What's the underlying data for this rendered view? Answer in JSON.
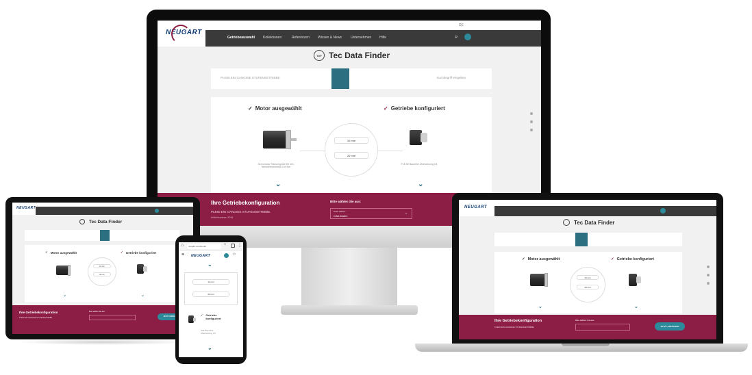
{
  "desktop": {
    "logo": "NEUGART",
    "nav_items": [
      "Getriebeauswahl",
      "Kollektionen",
      "Referenzen",
      "Wissen & News",
      "Unternehmen",
      "Hilfe"
    ],
    "lang": "DE",
    "page_title": "Tec Data Finder",
    "title_icon": "TDF",
    "search_left": "PLE60 EIN GANGIGE STUFENGETRIEBE",
    "search_right": "Suchbegriff eingeben",
    "motor_heading": "Motor ausgewählt",
    "gear_heading": "Getriebe konfiguriert",
    "value_top": "10 mm",
    "value_bottom": "20 mm",
    "motor_desc": "Servomotor Flanschgröße 60 mm, Nenndrehmoment 0,64 Nm",
    "gear_desc": "PLE 60 Baureihe Übersetzung i=5",
    "config_title": "Ihre Getriebekonfiguration",
    "config_product": "PLE60 EIN GANGIGE STUFENGETRIEBE",
    "config_article": "Artikelnummer: 5016",
    "config_question": "Bitte wählen Sie aus:",
    "config_select_label": "Datei wählen",
    "config_select_value": "CAD-Daten"
  },
  "tablet": {
    "logo": "NEUGART",
    "page_title": "Tec Data Finder",
    "motor_heading": "Motor ausgewählt",
    "gear_heading": "Getriebe konfiguriert",
    "value_top": "10 mm",
    "value_bottom": "20 mm",
    "config_title": "Ihre Getriebekonfiguration",
    "config_sub": "PLE60 EIN GANGIGE STUFENGETRIEBE",
    "config_question": "Bitte wählen Sie aus:",
    "button": "JETZT ANFRAGEN"
  },
  "phone": {
    "url": "neugart.com/de-de/",
    "logo": "NEUGART",
    "value_top": "10 mm",
    "value_bottom": "20 mm",
    "gear_heading": "Getriebe konfiguriert",
    "gear_desc": "PLE Baureihe Übersetzung i=5"
  },
  "laptop": {
    "logo": "NEUGART",
    "page_title": "Tec Data Finder",
    "motor_heading": "Motor ausgewählt",
    "gear_heading": "Getriebe konfiguriert",
    "value_top": "10 mm",
    "value_bottom": "20 mm",
    "config_title": "Ihre Getriebekonfiguration",
    "config_sub": "PLE60 EIN GANGIGE STUFENGETRIEBE",
    "config_question": "Bitte wählen Sie aus:",
    "button": "JETZT ANFRAGEN"
  },
  "colors": {
    "brand_red": "#8c1d45",
    "brand_teal": "#2c6f80",
    "nav_dark": "#3a3a3a",
    "logo_blue": "#123e73"
  }
}
